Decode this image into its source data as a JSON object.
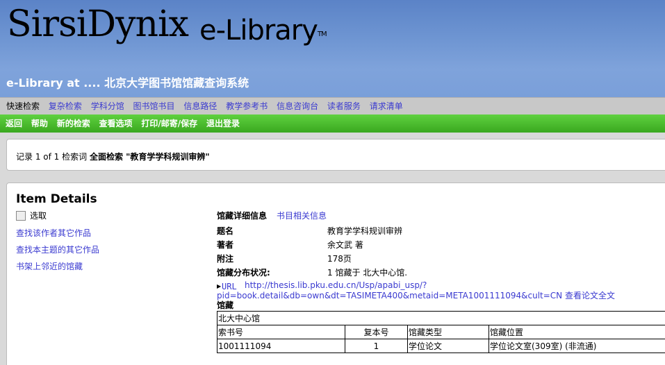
{
  "header": {
    "logo_main": "SirsiDynix",
    "logo_sub": "e-Library",
    "logo_tm": "TM",
    "site_title": "e-Library at .... 北京大学图书馆馆藏查询系统"
  },
  "nav": {
    "items": [
      {
        "label": "快速检索",
        "active": true
      },
      {
        "label": "复杂检索"
      },
      {
        "label": "学科分馆"
      },
      {
        "label": "图书馆书目"
      },
      {
        "label": "信息路径"
      },
      {
        "label": "教学参考书"
      },
      {
        "label": "信息咨询台"
      },
      {
        "label": "读者服务"
      },
      {
        "label": "请求清单"
      }
    ]
  },
  "toolbar": {
    "items": [
      "返回",
      "帮助",
      "新的检索",
      "查看选项",
      "打印/邮寄/保存",
      "退出登录"
    ]
  },
  "results": {
    "prefix": "记录 1 of 1 检索词",
    "query": "全面检索 \"教育学学科规训审辨\""
  },
  "details": {
    "title": "Item Details",
    "select_label": "选取",
    "side_links": [
      "查找该作者其它作品",
      "查找本主题的其它作品",
      "书架上邻近的馆藏"
    ],
    "tabs": {
      "holdings": "馆藏详细信息",
      "biblio": "书目相关信息"
    },
    "fields": [
      {
        "label": "题名",
        "value": "教育学学科规训审辨"
      },
      {
        "label": "著者",
        "value": "余文武 著"
      },
      {
        "label": "附注",
        "value": "178页"
      },
      {
        "label": "馆藏分布状况:",
        "value": "1 馆藏于 北大中心馆."
      }
    ],
    "url_label": "URL",
    "url_line1": "http://thesis.lib.pku.edu.cn/Usp/apabi_usp/?",
    "url_line2": "pid=book.detail&db=own&dt=TASIMETA400&metaid=META1001111094&cult=CN 查看论文全文",
    "holdings_title": "馆藏",
    "library_name": "北大中心馆",
    "table": {
      "headers": [
        "索书号",
        "复本号",
        "馆藏类型",
        "馆藏位置"
      ],
      "rows": [
        [
          "1001111094",
          "1",
          "学位论文",
          "学位论文室(309室) (非流通)"
        ]
      ]
    }
  }
}
